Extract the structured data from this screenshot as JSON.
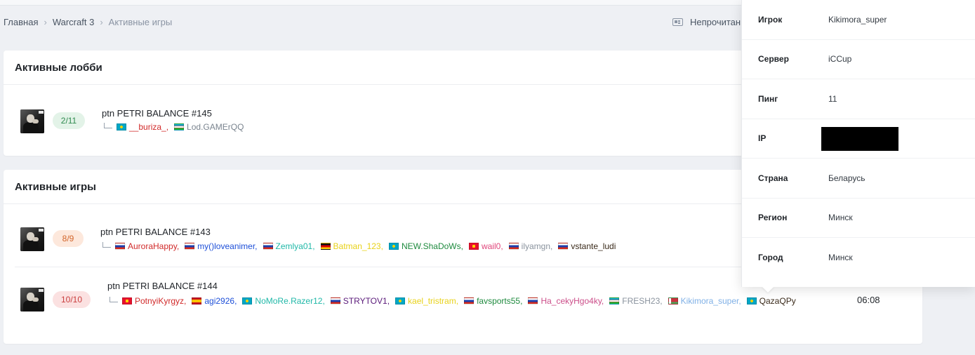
{
  "breadcrumb": {
    "items": [
      {
        "label": "Главная"
      },
      {
        "label": "Warcraft 3"
      },
      {
        "label": "Активные игры"
      }
    ]
  },
  "header": {
    "unread_label": "Непрочитан"
  },
  "lobbies": {
    "title": "Активные лобби",
    "games": [
      {
        "title": "ptn PETRI BALANCE #145",
        "slots": "2/11",
        "players": [
          {
            "name": "__buriza_,",
            "color": "#d12a2a",
            "flag": "kz"
          },
          {
            "name": "Lod.GAMErQQ",
            "color": "#7a848f",
            "flag": "uz"
          }
        ]
      }
    ]
  },
  "active_games": {
    "title": "Активные игры",
    "games": [
      {
        "title": "ptn PETRI BALANCE #143",
        "slots": "8/9",
        "players": [
          {
            "name": "AuroraHappy,",
            "color": "#d12a2a",
            "flag": "ru"
          },
          {
            "name": "my()loveanimer,",
            "color": "#1d4fd8",
            "flag": "ru"
          },
          {
            "name": "Zemlya01,",
            "color": "#20b8a8",
            "flag": "ru"
          },
          {
            "name": "Batman_123,",
            "color": "#e8d21a",
            "flag": "de"
          },
          {
            "name": "NEW.ShaDoWs,",
            "color": "#1e8a3e",
            "flag": "kz"
          },
          {
            "name": "wail0,",
            "color": "#e0457b",
            "flag": "kg"
          },
          {
            "name": "ilyamgn,",
            "color": "#8a939e",
            "flag": "ru"
          },
          {
            "name": "vstante_ludi",
            "color": "#3a2a1a",
            "flag": "ru"
          }
        ]
      },
      {
        "title": "ptn PETRI BALANCE #144",
        "slots": "10/10",
        "time": "06:08",
        "players": [
          {
            "name": "PotnyiKyrgyz,",
            "color": "#d12a2a",
            "flag": "kg"
          },
          {
            "name": "agi2926,",
            "color": "#1d4fd8",
            "flag": "es"
          },
          {
            "name": "NoMoRe.Razer12,",
            "color": "#20b8a8",
            "flag": "kz"
          },
          {
            "name": "STRYTOV1,",
            "color": "#5a1a7a",
            "flag": "ru"
          },
          {
            "name": "kael_tristram,",
            "color": "#e8d21a",
            "flag": "kz"
          },
          {
            "name": "favsports55,",
            "color": "#1e8a3e",
            "flag": "ru"
          },
          {
            "name": "Ha_cekyHgo4ky,",
            "color": "#cc4f8a",
            "flag": "ru"
          },
          {
            "name": "FRESH23,",
            "color": "#8a939e",
            "flag": "uz"
          },
          {
            "name": "Kikimora_super,",
            "color": "#7fb0e6",
            "flag": "by"
          },
          {
            "name": "QazaQPy",
            "color": "#3a2a1a",
            "flag": "kz"
          }
        ]
      }
    ]
  },
  "popover": {
    "rows": [
      {
        "label": "Игрок",
        "value": "Kikimora_super"
      },
      {
        "label": "Сервер",
        "value": "iCCup"
      },
      {
        "label": "Пинг",
        "value": "11"
      },
      {
        "label": "IP",
        "value": ""
      },
      {
        "label": "Страна",
        "value": "Беларусь"
      },
      {
        "label": "Регион",
        "value": "Минск"
      },
      {
        "label": "Город",
        "value": "Минск"
      }
    ]
  }
}
